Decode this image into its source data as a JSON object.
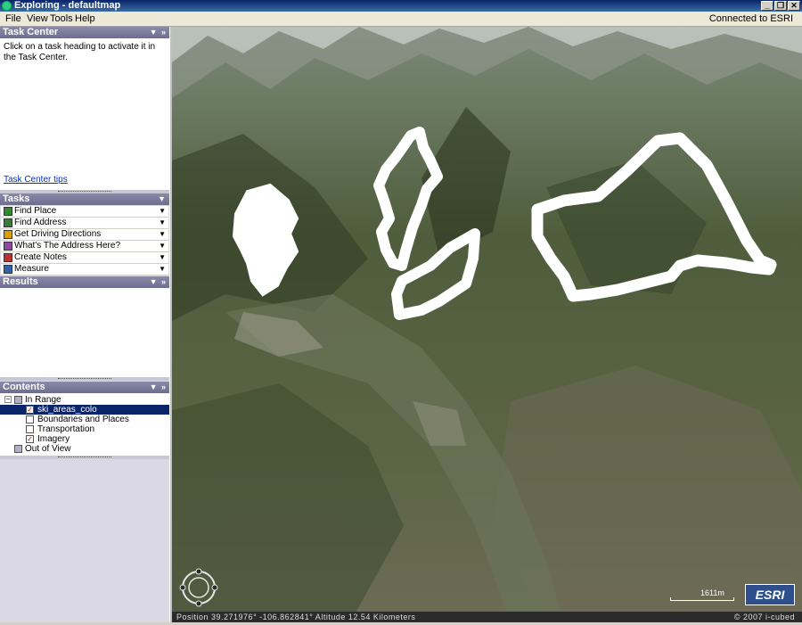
{
  "window": {
    "title": "Exploring - defaultmap",
    "buttons": [
      "_",
      "❐",
      "✕"
    ]
  },
  "menu": {
    "items": [
      "File",
      "View",
      "Tools",
      "Help"
    ],
    "status": "Connected to ESRI"
  },
  "task_center": {
    "header": "Task Center",
    "message": "Click on a task heading to activate it in the Task Center.",
    "tips_link": "Task Center tips"
  },
  "tasks": {
    "header": "Tasks",
    "items": [
      {
        "label": "Find Place",
        "icon": "find-place-icon",
        "color": "#2e8b2e"
      },
      {
        "label": "Find Address",
        "icon": "find-address-icon",
        "color": "#3a7a3a"
      },
      {
        "label": "Get Driving Directions",
        "icon": "driving-directions-icon",
        "color": "#d8a000"
      },
      {
        "label": "What's The Address Here?",
        "icon": "address-here-icon",
        "color": "#8a4aa0"
      },
      {
        "label": "Create Notes",
        "icon": "create-notes-icon",
        "color": "#c03030"
      },
      {
        "label": "Measure",
        "icon": "measure-icon",
        "color": "#3060b0"
      }
    ]
  },
  "results": {
    "header": "Results"
  },
  "contents": {
    "header": "Contents",
    "in_range": "In Range",
    "layers": [
      {
        "label": "ski_areas_colo",
        "checked": true,
        "selected": true
      },
      {
        "label": "Boundaries and Places",
        "checked": false,
        "selected": false
      },
      {
        "label": "Transportation",
        "checked": false,
        "selected": false
      },
      {
        "label": "Imagery",
        "checked": true,
        "selected": false
      }
    ],
    "out_of_view": "Out of View"
  },
  "map": {
    "status_position": "Position 39.271976°  -106.862841°  Altitude  12.54 Kilometers",
    "copyright": "© 2007 i-cubed",
    "scale_label": "1611m",
    "logo": "ESRI"
  }
}
